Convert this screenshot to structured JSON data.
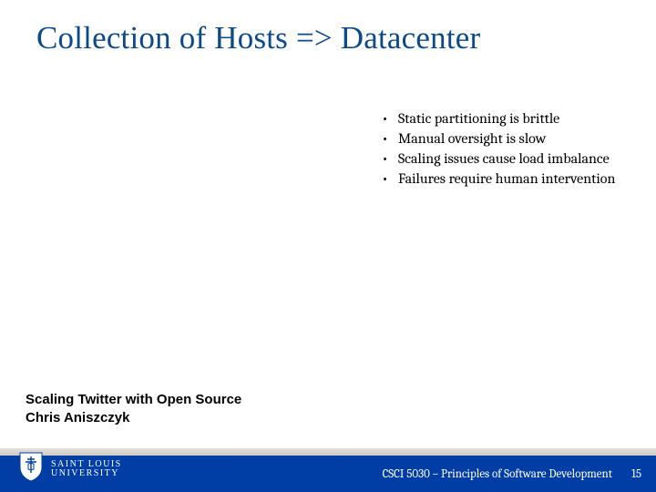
{
  "title": "Collection of Hosts => Datacenter",
  "bullets": [
    "Static partitioning is brittle",
    "Manual oversight is slow",
    "Scaling issues cause load imbalance",
    "Failures require human intervention"
  ],
  "attribution": {
    "line1": "Scaling Twitter with Open Source",
    "line2": "Chris Aniszczyk"
  },
  "footer": {
    "course": "CSCI 5030 – Principles of Software Development",
    "page": "15"
  },
  "logo": {
    "top": "SAINT LOUIS",
    "bottom": "UNIVERSITY"
  },
  "colors": {
    "title": "#0b4a8a",
    "footer_band": "#003da5"
  }
}
